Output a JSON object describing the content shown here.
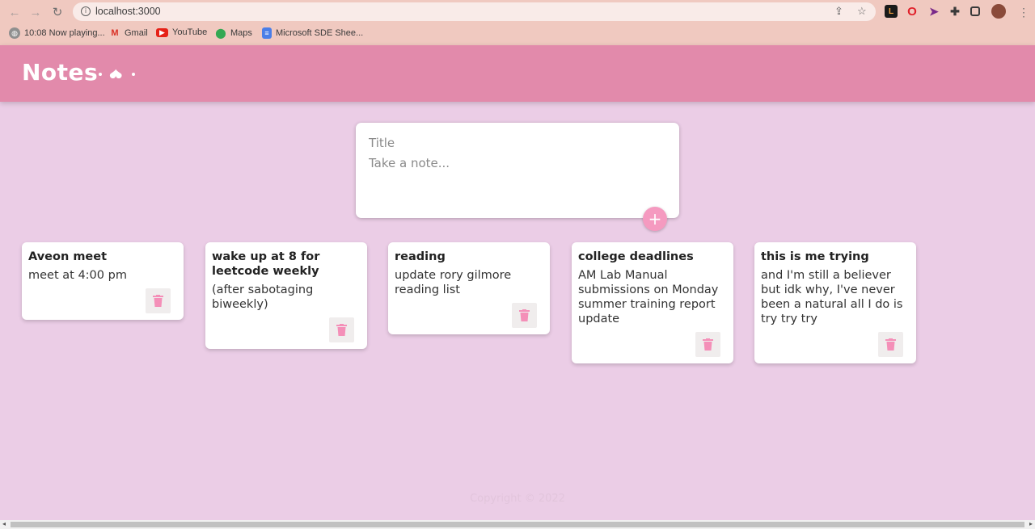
{
  "browser": {
    "url": "localhost:3000",
    "bookmarks": [
      {
        "label": "10:08 Now playing...",
        "icon": "globe-icon"
      },
      {
        "label": "Gmail",
        "icon": "gmail-icon"
      },
      {
        "label": "YouTube",
        "icon": "youtube-icon"
      },
      {
        "label": "Maps",
        "icon": "maps-icon"
      },
      {
        "label": "Microsoft SDE Shee...",
        "icon": "docs-icon"
      }
    ]
  },
  "header": {
    "title": "Notes"
  },
  "create": {
    "title_placeholder": "Title",
    "content_placeholder": "Take a note...",
    "add_label": "+"
  },
  "notes": [
    {
      "title": "Aveon meet",
      "content": "meet at 4:00 pm"
    },
    {
      "title": "wake up at 8 for leetcode weekly",
      "content": "(after sabotaging biweekly)"
    },
    {
      "title": "reading",
      "content": "update rory gilmore reading list"
    },
    {
      "title": "college deadlines",
      "content": "AM Lab Manual submissions on Monday summer training report update"
    },
    {
      "title": "this is me trying",
      "content": "and I'm still a believer but idk why, I've never been a natural all I do is try try try"
    }
  ],
  "footer": {
    "text": "Copyright © 2022"
  },
  "colors": {
    "background": "#ebcde6",
    "header": "#e28aab",
    "accent": "#f59ac0"
  }
}
